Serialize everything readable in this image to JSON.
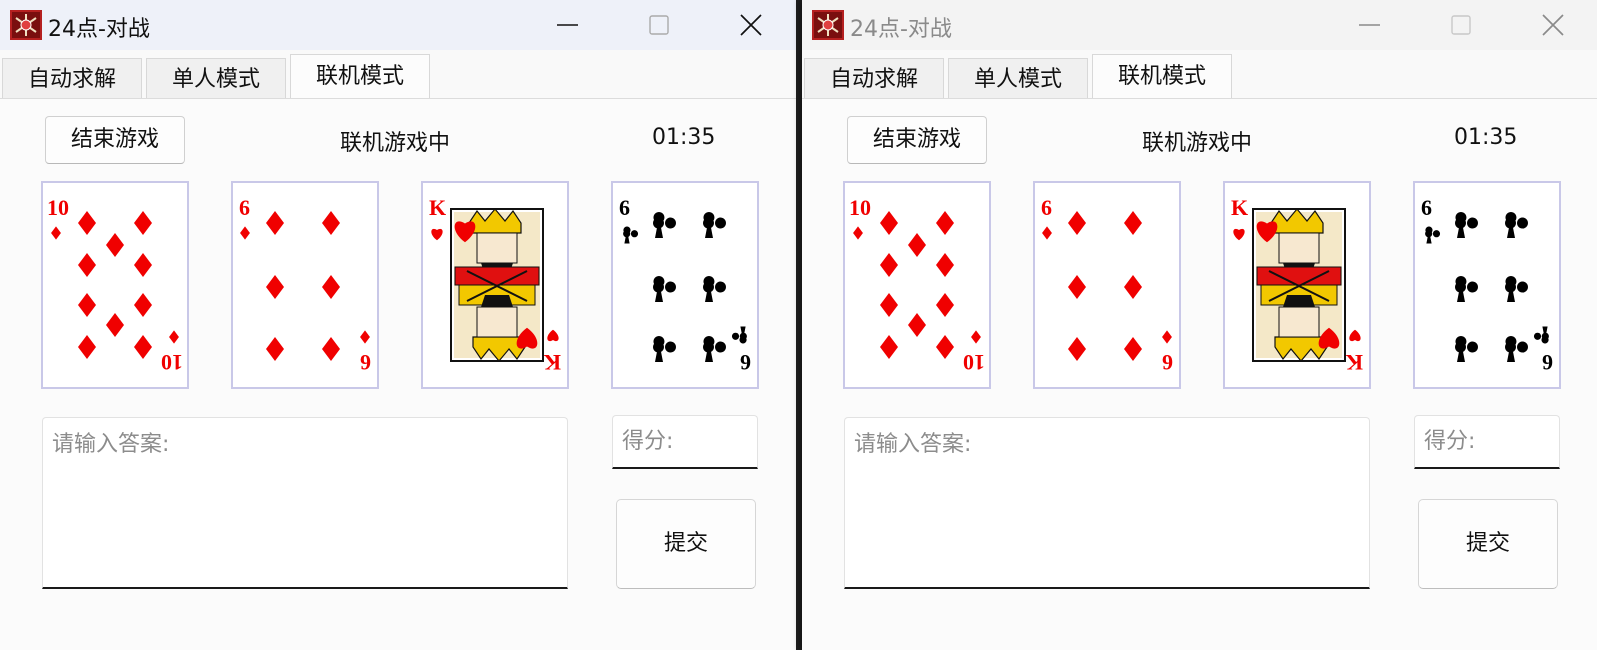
{
  "windows": [
    {
      "title": "24点-对战",
      "tabs": [
        {
          "label": "自动求解"
        },
        {
          "label": "单人模式"
        },
        {
          "label": "联机模式"
        }
      ],
      "active_tab": 2,
      "end_button": "结束游戏",
      "status": "联机游戏中",
      "timer": "01:35",
      "cards": [
        {
          "rank": "10",
          "suit": "diamonds",
          "color": "#f00000"
        },
        {
          "rank": "6",
          "suit": "diamonds",
          "color": "#f00000"
        },
        {
          "rank": "K",
          "suit": "hearts",
          "color": "#f00000"
        },
        {
          "rank": "6",
          "suit": "clubs",
          "color": "#000000"
        }
      ],
      "answer_placeholder": "请输入答案:",
      "score_placeholder": "得分:",
      "submit_label": "提交"
    },
    {
      "title": "24点-对战",
      "tabs": [
        {
          "label": "自动求解"
        },
        {
          "label": "单人模式"
        },
        {
          "label": "联机模式"
        }
      ],
      "active_tab": 2,
      "end_button": "结束游戏",
      "status": "联机游戏中",
      "timer": "01:35",
      "cards": [
        {
          "rank": "10",
          "suit": "diamonds",
          "color": "#f00000"
        },
        {
          "rank": "6",
          "suit": "diamonds",
          "color": "#f00000"
        },
        {
          "rank": "K",
          "suit": "hearts",
          "color": "#f00000"
        },
        {
          "rank": "6",
          "suit": "clubs",
          "color": "#000000"
        }
      ],
      "answer_placeholder": "请输入答案:",
      "score_placeholder": "得分:",
      "submit_label": "提交"
    }
  ]
}
